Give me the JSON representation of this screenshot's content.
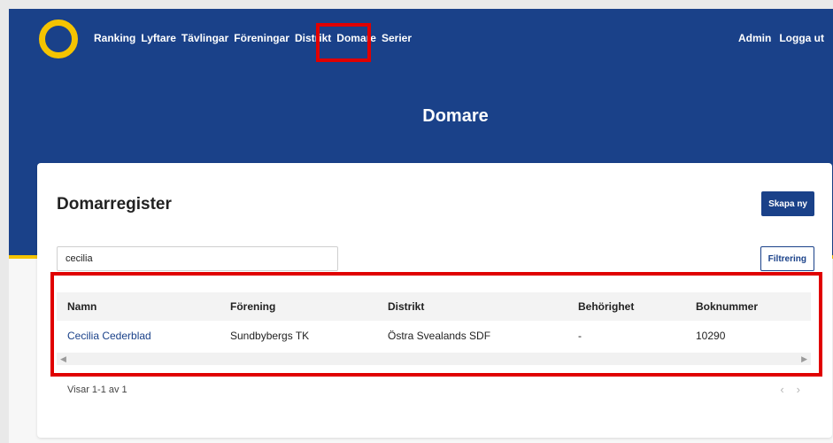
{
  "nav": {
    "items": [
      "Ranking",
      "Lyftare",
      "Tävlingar",
      "Föreningar",
      "Distrikt",
      "Domare",
      "Serier"
    ],
    "right": [
      "Admin",
      "Logga ut"
    ]
  },
  "page": {
    "title": "Domare"
  },
  "register": {
    "title": "Domarregister",
    "create_label": "Skapa ny",
    "search_value": "cecilia",
    "filter_label": "Filtrering"
  },
  "table": {
    "headers": [
      "Namn",
      "Förening",
      "Distrikt",
      "Behörighet",
      "Boknummer"
    ],
    "rows": [
      [
        "Cecilia Cederblad",
        "Sundbybergs TK",
        "Östra Svealands SDF",
        "-",
        "10290"
      ]
    ]
  },
  "footer": {
    "summary": "Visar 1-1 av 1",
    "prev": "‹",
    "next": "›"
  },
  "colors": {
    "brand": "#1a4189",
    "accent": "#f5c400",
    "highlight": "#e00000"
  }
}
